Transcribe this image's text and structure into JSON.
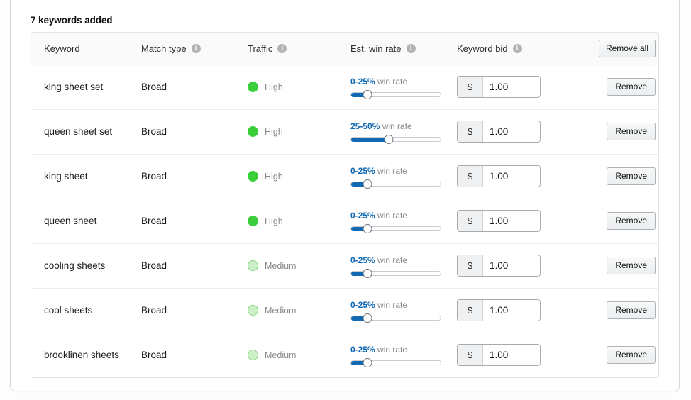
{
  "card": {
    "section_title": "7 keywords added"
  },
  "table": {
    "columns": [
      {
        "key": "keyword",
        "label": "Keyword",
        "info": false
      },
      {
        "key": "match",
        "label": "Match type",
        "info": true
      },
      {
        "key": "traffic",
        "label": "Traffic",
        "info": true
      },
      {
        "key": "winrate",
        "label": "Est. win rate",
        "info": true
      },
      {
        "key": "bid",
        "label": "Keyword bid",
        "info": true
      }
    ],
    "remove_all_label": "Remove all",
    "row_remove_label": "Remove",
    "bid_currency_symbol": "$",
    "winrate_suffix": "win rate",
    "rows": [
      {
        "keyword": "king sheet set",
        "match": "Broad",
        "traffic": "High",
        "traffic_level": "high",
        "winrate_range": "0-25%",
        "winrate_percent": 18,
        "bid": "1.00"
      },
      {
        "keyword": "queen sheet set",
        "match": "Broad",
        "traffic": "High",
        "traffic_level": "high",
        "winrate_range": "25-50%",
        "winrate_percent": 42,
        "bid": "1.00"
      },
      {
        "keyword": "king sheet",
        "match": "Broad",
        "traffic": "High",
        "traffic_level": "high",
        "winrate_range": "0-25%",
        "winrate_percent": 18,
        "bid": "1.00"
      },
      {
        "keyword": "queen sheet",
        "match": "Broad",
        "traffic": "High",
        "traffic_level": "high",
        "winrate_range": "0-25%",
        "winrate_percent": 18,
        "bid": "1.00"
      },
      {
        "keyword": "cooling sheets",
        "match": "Broad",
        "traffic": "Medium",
        "traffic_level": "medium",
        "winrate_range": "0-25%",
        "winrate_percent": 18,
        "bid": "1.00"
      },
      {
        "keyword": "cool sheets",
        "match": "Broad",
        "traffic": "Medium",
        "traffic_level": "medium",
        "winrate_range": "0-25%",
        "winrate_percent": 18,
        "bid": "1.00"
      },
      {
        "keyword": "brooklinen sheets",
        "match": "Broad",
        "traffic": "Medium",
        "traffic_level": "medium",
        "winrate_range": "0-25%",
        "winrate_percent": 18,
        "bid": "1.00"
      }
    ]
  },
  "colors": {
    "accent_blue": "#1168b3",
    "traffic_high": "#3ace3a",
    "traffic_medium": "#cdf0c8",
    "info_icon": "#b3b3b3"
  }
}
